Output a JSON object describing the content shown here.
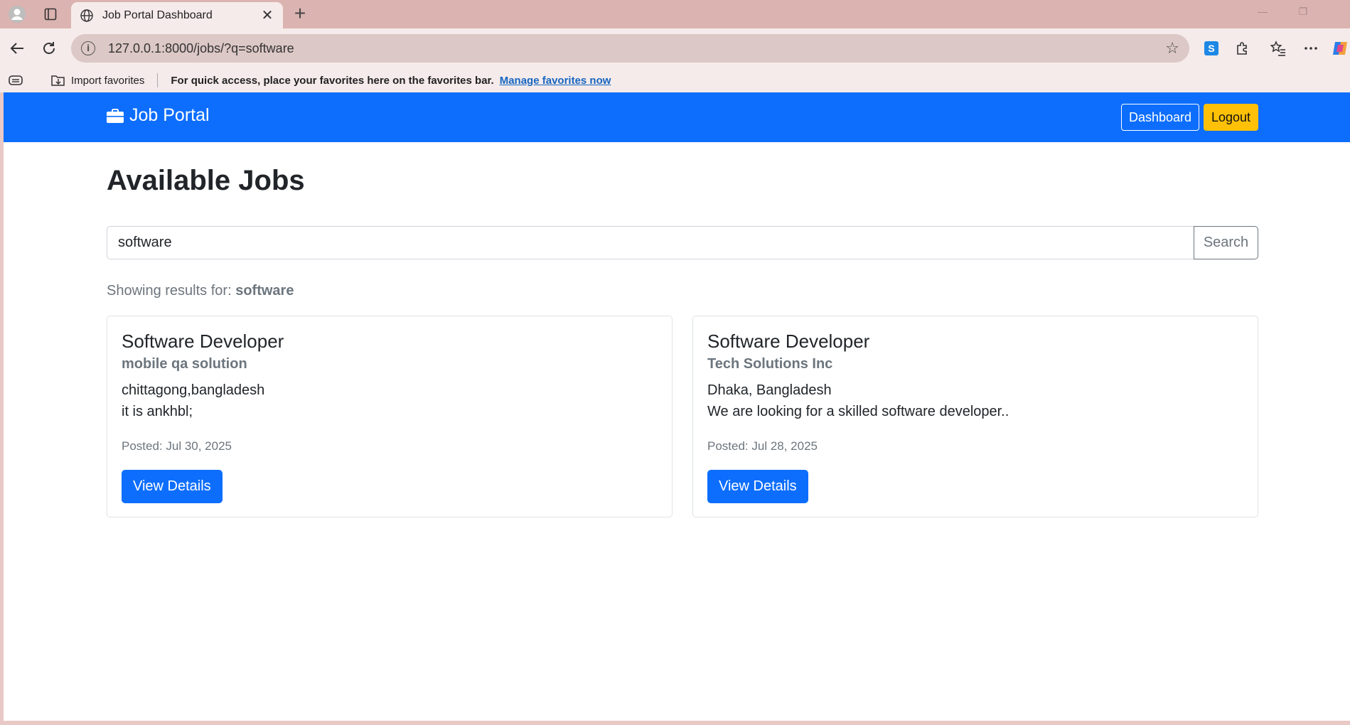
{
  "browser": {
    "tab_title": "Job Portal Dashboard",
    "url": "127.0.0.1:8000/jobs/?q=software",
    "favorites_bar": {
      "import_label": "Import favorites",
      "hint": "For quick access, place your favorites here on the favorites bar.",
      "manage_link": "Manage favorites now"
    }
  },
  "navbar": {
    "brand": "Job Portal",
    "dashboard_label": "Dashboard",
    "logout_label": "Logout",
    "colors": {
      "navbar": "#0d6efd",
      "logout": "#ffc107"
    }
  },
  "main": {
    "heading": "Available Jobs",
    "search": {
      "value": "software",
      "button_label": "Search"
    },
    "results_prefix": "Showing results for:",
    "results_query": "software",
    "jobs": [
      {
        "title": "Software Developer",
        "company": "mobile qa solution",
        "location": "chittagong,bangladesh",
        "description": "it is ankhbl;",
        "posted": "Posted: Jul 30, 2025",
        "button_label": "View Details"
      },
      {
        "title": "Software Developer",
        "company": "Tech Solutions Inc",
        "location": "Dhaka, Bangladesh",
        "description": "We are looking for a skilled software developer..",
        "posted": "Posted: Jul 28, 2025",
        "button_label": "View Details"
      }
    ]
  }
}
